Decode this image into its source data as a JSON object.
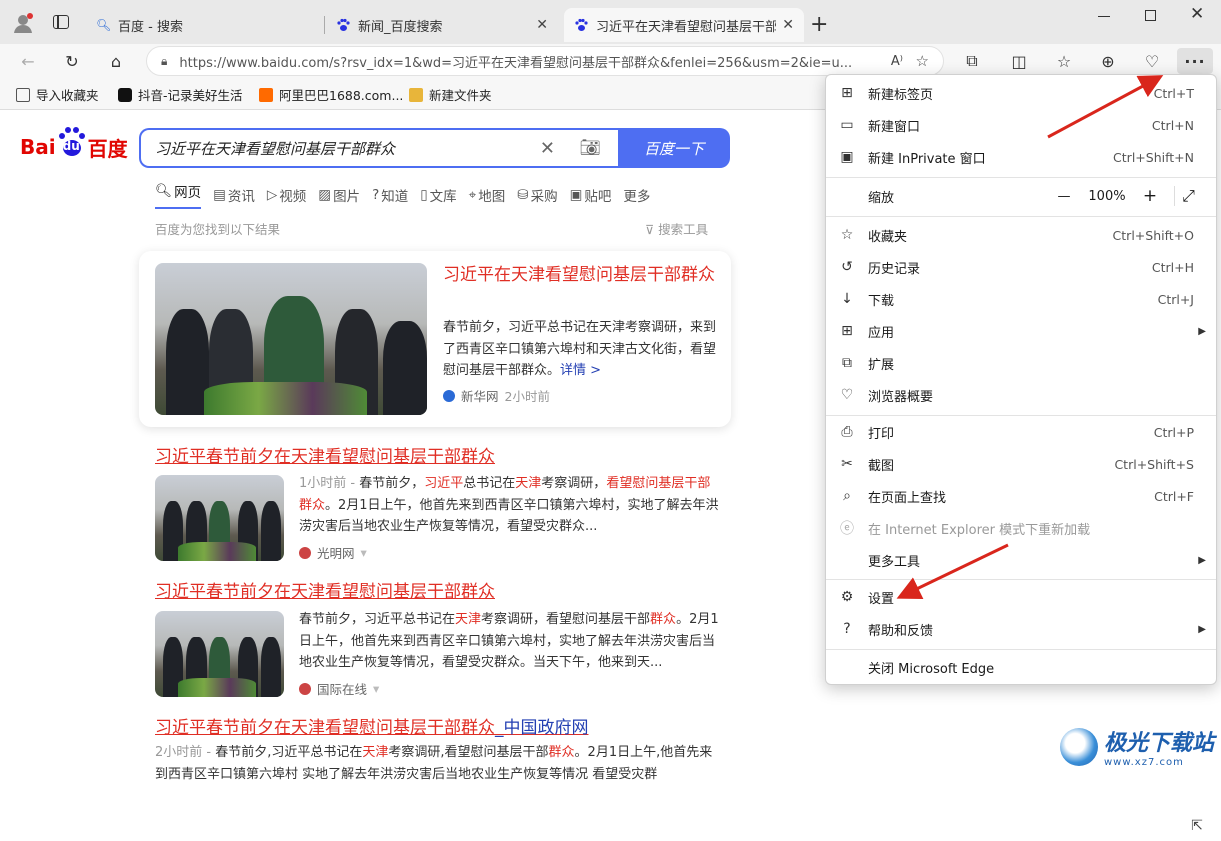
{
  "tabs": [
    {
      "title": "百度 - 搜索",
      "active": false
    },
    {
      "title": "新闻_百度搜索",
      "active": false
    },
    {
      "title": "习近平在天津看望慰问基层干部群众",
      "active": true
    }
  ],
  "toolbar": {
    "url": "https://www.baidu.com/s?rsv_idx=1&wd=习近平在天津看望慰问基层干部群众&fenlei=256&usm=2&ie=u..."
  },
  "bookmarks": [
    {
      "label": "导入收藏夹",
      "color": "#555"
    },
    {
      "label": "抖音-记录美好生活",
      "color": "#111"
    },
    {
      "label": "阿里巴巴1688.com...",
      "color": "#ff6a00"
    },
    {
      "label": "新建文件夹",
      "color": "#e8b53a"
    }
  ],
  "baidu": {
    "logo_a": "Bai",
    "logo_b": "du",
    "logo_c": "百度",
    "query": "习近平在天津看望慰问基层干部群众",
    "search_button": "百度一下",
    "nav": [
      "网页",
      "资讯",
      "视频",
      "图片",
      "知道",
      "文库",
      "地图",
      "采购",
      "贴吧",
      "更多"
    ],
    "found_text": "百度为您找到以下结果",
    "tools_text": "搜索工具"
  },
  "results": [
    {
      "title": "习近平在天津看望慰问基层干部群众",
      "body": "春节前夕，习近平总书记在天津考察调研，来到了西青区辛口镇第六埠村和天津古文化街，看望慰问基层干部群众。",
      "more": "详情 >",
      "source": "新华网",
      "time": "2小时前"
    },
    {
      "title": "习近平春节前夕在天津看望慰问基层干部群众",
      "time": "1小时前 - ",
      "body_a": "春节前夕，",
      "body_b": "习近平",
      "body_c": "总书记在",
      "body_d": "天津",
      "body_e": "考察调研，",
      "body_f": "看望慰问基层干部群众",
      "body_g": "。2月1日上午，他首先来到西青区辛口镇第六埠村，实地了解去年洪涝灾害后当地农业生产恢复等情况，看望受灾群众...",
      "source": "光明网"
    },
    {
      "title": "习近平春节前夕在天津看望慰问基层干部群众",
      "body_a": "春节前夕，习近平总书记在",
      "body_b": "天津",
      "body_c": "考察调研，看望慰问基层干部",
      "body_d": "群众",
      "body_e": "。2月1日上午，他首先来到西青区辛口镇第六埠村，实地了解去年洪涝灾害后当地农业生产恢复等情况，看望受灾群众。当天下午，他来到天...",
      "source": "国际在线"
    },
    {
      "title": "习近平春节前夕在天津看望慰问基层干部群众",
      "title_suffix": "_中国政府网",
      "time": "2小时前 - ",
      "body_a": "春节前夕,习近平总书记在",
      "body_b": "天津",
      "body_c": "考察调研,看望慰问基层干部",
      "body_d": "群众",
      "body_e": "。2月1日上午,他首先来到",
      "body_f": "西青区辛口镇第六埠村 实地了解去年洪涝灾害后当地农业生产恢复等情况 看望受灾群"
    }
  ],
  "menu": {
    "items": [
      {
        "label": "新建标签页",
        "shortcut": "Ctrl+T",
        "icon": "new-tab-icon"
      },
      {
        "label": "新建窗口",
        "shortcut": "Ctrl+N",
        "icon": "new-window-icon"
      },
      {
        "label": "新建 InPrivate 窗口",
        "shortcut": "Ctrl+Shift+N",
        "icon": "inprivate-icon"
      },
      {
        "label": "缩放",
        "icon": ""
      },
      {
        "label": "收藏夹",
        "shortcut": "Ctrl+Shift+O",
        "icon": "favorites-icon"
      },
      {
        "label": "历史记录",
        "shortcut": "Ctrl+H",
        "icon": "history-icon"
      },
      {
        "label": "下载",
        "shortcut": "Ctrl+J",
        "icon": "download-icon"
      },
      {
        "label": "应用",
        "icon": "apps-icon"
      },
      {
        "label": "扩展",
        "icon": "extensions-icon"
      },
      {
        "label": "浏览器概要",
        "icon": "browser-essentials-icon"
      },
      {
        "label": "打印",
        "shortcut": "Ctrl+P",
        "icon": "print-icon"
      },
      {
        "label": "截图",
        "shortcut": "Ctrl+Shift+S",
        "icon": "screenshot-icon"
      },
      {
        "label": "在页面上查找",
        "shortcut": "Ctrl+F",
        "icon": "find-icon"
      },
      {
        "label": "在 Internet Explorer 模式下重新加载",
        "icon": "ie-mode-icon"
      },
      {
        "label": "更多工具",
        "icon": ""
      },
      {
        "label": "设置",
        "icon": "settings-icon"
      },
      {
        "label": "帮助和反馈",
        "icon": "help-icon"
      },
      {
        "label": "关闭 Microsoft Edge",
        "icon": ""
      }
    ],
    "zoom_value": "100%",
    "zoom_minus": "—",
    "zoom_plus": "+"
  },
  "watermark": {
    "text": "极光下载站",
    "sub": "www.xz7.com"
  },
  "colors": {
    "accent": "#4e6ef2",
    "result_title": "#e02e24",
    "arrow": "#d9261c"
  }
}
